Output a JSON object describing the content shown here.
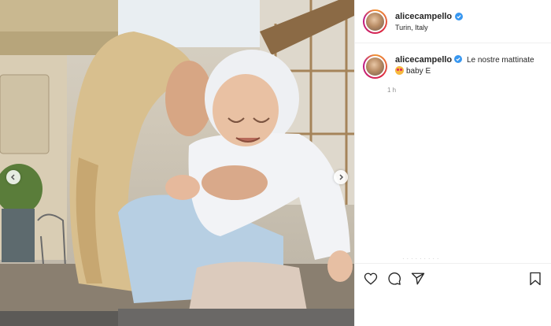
{
  "post": {
    "username": "alicecampello",
    "location": "Turin, Italy",
    "caption": {
      "text_before_emoji": "Le nostre mattinate",
      "text_after_emoji": "baby E",
      "emoji": "star-struck-emoji"
    },
    "time_ago": "1 h",
    "faded_text": "· · · · · · · · ·",
    "verified": true
  },
  "icons": {
    "like": "heart-icon",
    "comment": "comment-icon",
    "share": "share-icon",
    "save": "bookmark-icon",
    "prev": "chevron-left-icon",
    "next": "chevron-right-icon"
  },
  "colors": {
    "verified_blue": "#3897f0",
    "text": "#262626",
    "muted": "#8e8e8e"
  }
}
